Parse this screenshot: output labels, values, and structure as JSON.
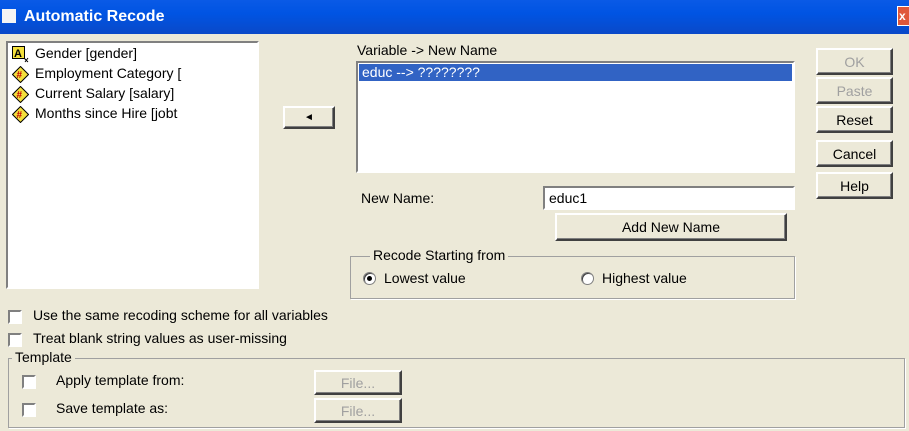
{
  "window": {
    "title": "Automatic Recode",
    "close_glyph": "x"
  },
  "variables": [
    {
      "label": "Gender [gender]",
      "icon": "string-variable-icon"
    },
    {
      "label": "Employment Category [",
      "icon": "nominal-variable-icon"
    },
    {
      "label": "Current Salary [salary]",
      "icon": "scale-variable-icon"
    },
    {
      "label": "Months since Hire [jobt",
      "icon": "scale-variable-icon"
    }
  ],
  "transfer_button": {
    "glyph": "◄"
  },
  "mapping": {
    "header": "Variable -> New Name",
    "rows": [
      "educ --> ????????"
    ]
  },
  "new_name": {
    "label": "New Name:",
    "value": "educ1",
    "add_button": "Add New Name"
  },
  "recode_group": {
    "legend": "Recode Starting from",
    "lowest": "Lowest value",
    "highest": "Highest value",
    "selected": "lowest"
  },
  "buttons": {
    "ok": "OK",
    "paste": "Paste",
    "reset": "Reset",
    "cancel": "Cancel",
    "help": "Help"
  },
  "options": {
    "same_scheme": "Use the same recoding scheme for all variables",
    "blank_missing": "Treat blank string values as user-missing"
  },
  "template": {
    "legend": "Template",
    "apply_label": "Apply template from:",
    "save_label": "Save template as:",
    "file_button": "File..."
  },
  "colors": {
    "title_bar": "#0054e3",
    "selection": "#3163c4",
    "dialog_bg": "#ece9d8",
    "disabled_text": "#a0a0a0"
  }
}
